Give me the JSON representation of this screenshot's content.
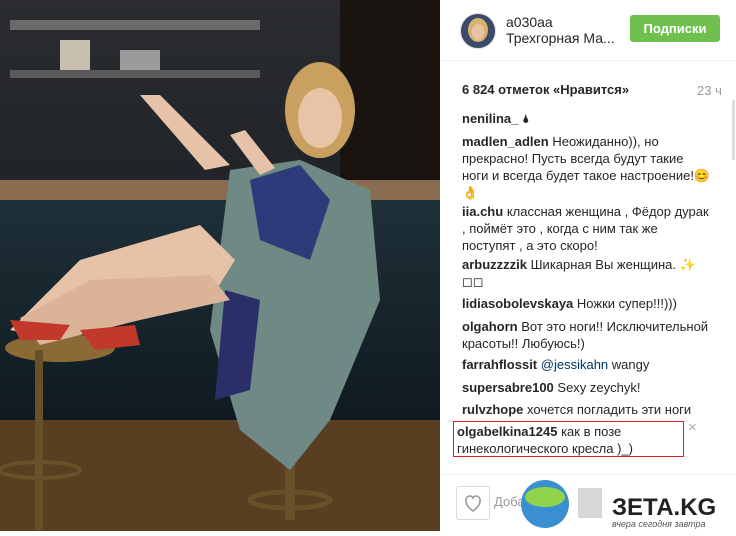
{
  "header": {
    "username": "a030aa",
    "location": "Трехгорная Ма..."
  },
  "follow_button": "Подписки",
  "likes": "6 824 отметок «Нравится»",
  "time": "23 ч",
  "comments": [
    {
      "user": "nenilina_",
      "text": "🌢"
    },
    {
      "user": "madlen_adlen",
      "text": "Неожиданно)), но прекрасно! Пусть всегда будут такие ноги и всегда будет такое настроение!😊👌"
    },
    {
      "user": "iia.chu",
      "text": "классная женщина , Фёдор дурак , поймёт это , когда с ним так же поступят , а это скоро!"
    },
    {
      "user": "arbuzzzzik",
      "text": "Шикарная Вы женщина. ✨ ◻◻"
    },
    {
      "user": "lidiasobolevskaya",
      "text": "Ножки супер!!!)))"
    },
    {
      "user": "olgahorn",
      "text": "Вот это ноги!! Исключительной красоты!! Любуюсь!)"
    },
    {
      "user": "farrahflossit",
      "mention": "@jessikahn",
      "text": "wangy"
    },
    {
      "user": "supersabre100",
      "text": "Sexy zeychyk!"
    },
    {
      "user": "rulvzhope",
      "text": "хочется погладить эти ноги"
    },
    {
      "user": "olgabelkina1245",
      "text": "как в позе гинекологического кресла )_)"
    }
  ],
  "close_icon": "×",
  "add_comment_placeholder": "Доба...",
  "watermark": {
    "name": "ЗЕТА.KG",
    "tagline": "вчера сегодня завтра"
  },
  "colors": {
    "follow": "#70c050",
    "highlight": "#e02020"
  }
}
